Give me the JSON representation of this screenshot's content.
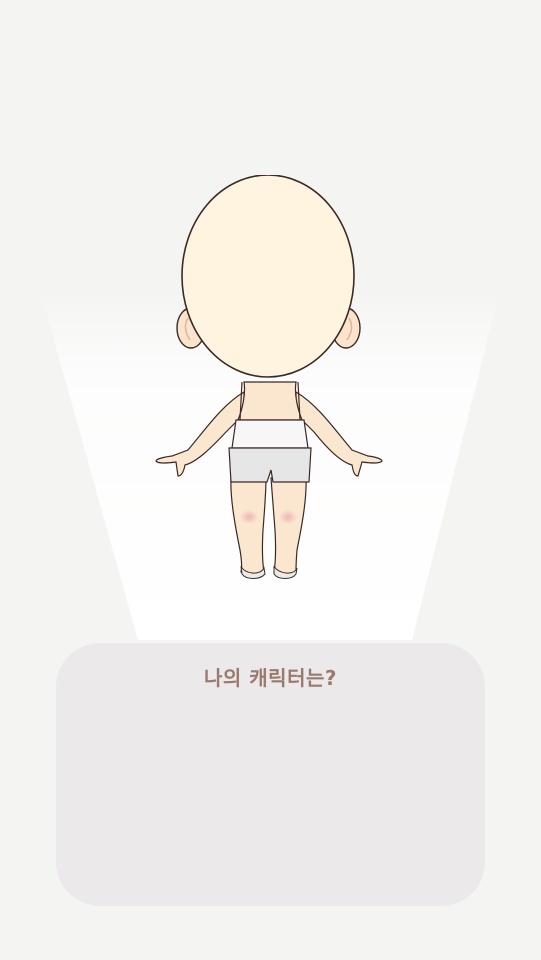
{
  "screen": {
    "background_color": "#f4f5f3"
  },
  "character": {
    "icon": "chibi-character-base-icon",
    "skin_color": "#fff4e0",
    "outline_color": "#3a2a26"
  },
  "info_panel": {
    "title": "나의 캐릭터는?",
    "background_color": "#ebe9ea",
    "title_color": "#9a7a6e",
    "content": ""
  }
}
